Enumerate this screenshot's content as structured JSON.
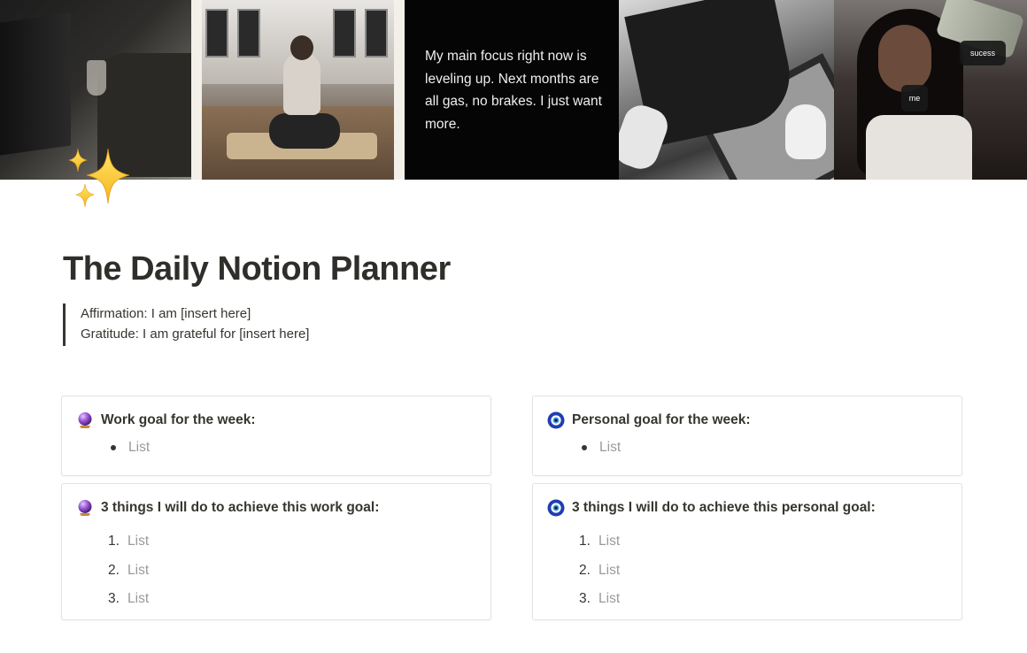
{
  "cover": {
    "quote": "My main focus right now is leveling up. Next months are all gas, no brakes. I just want more.",
    "chip_success": "sucess",
    "chip_me": "me"
  },
  "page": {
    "icon": "sparkles-icon",
    "title": "The Daily Notion Planner"
  },
  "callout": {
    "affirmation": "Affirmation: I am [insert here]",
    "gratitude": "Gratitude: I am grateful for [insert here]"
  },
  "cards": {
    "work_goal": {
      "icon": "crystal-ball-icon",
      "heading": "Work goal for the week:",
      "items": [
        "List"
      ]
    },
    "personal_goal": {
      "icon": "nazar-amulet-icon",
      "heading": "Personal goal for the week:",
      "items": [
        "List"
      ]
    },
    "work_steps": {
      "icon": "crystal-ball-icon",
      "heading": "3 things I will do to achieve this work goal:",
      "items": [
        {
          "num": "1.",
          "text": "List"
        },
        {
          "num": "2.",
          "text": "List"
        },
        {
          "num": "3.",
          "text": "List"
        }
      ]
    },
    "personal_steps": {
      "icon": "nazar-amulet-icon",
      "heading": "3 things I will do to achieve this personal goal:",
      "items": [
        {
          "num": "1.",
          "text": "List"
        },
        {
          "num": "2.",
          "text": "List"
        },
        {
          "num": "3.",
          "text": "List"
        }
      ]
    }
  },
  "colors": {
    "text": "#37352f",
    "placeholder": "#9b9a97",
    "border": "#e3e2df",
    "cover_quote_bg": "#050505"
  }
}
